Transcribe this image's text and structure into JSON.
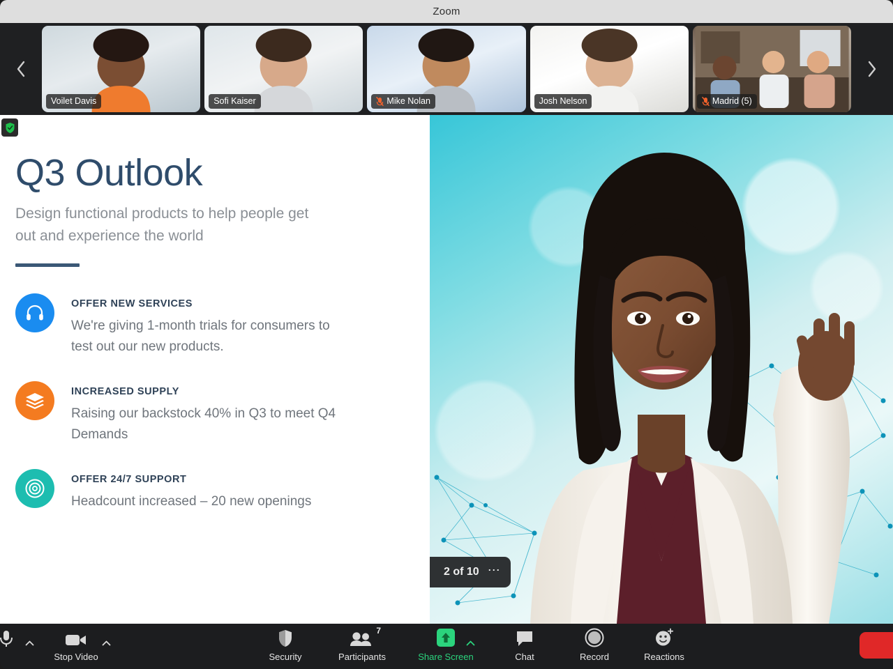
{
  "window": {
    "title": "Zoom"
  },
  "filmstrip": {
    "prev_icon": "chevron-left-icon",
    "next_icon": "chevron-right-icon",
    "participants": [
      {
        "name": "Voilet Davis",
        "muted": false,
        "active": false
      },
      {
        "name": "Sofi Kaiser",
        "muted": false,
        "active": false
      },
      {
        "name": "Mike Nolan",
        "muted": true,
        "active": true
      },
      {
        "name": "Josh Nelson",
        "muted": false,
        "active": false
      },
      {
        "name": "Madrid (5)",
        "muted": true,
        "active": false
      }
    ]
  },
  "slide": {
    "screen_share_badge_icon": "green-shield-icon",
    "title": "Q3 Outlook",
    "subtitle": "Design functional products to help people get out and experience the world",
    "bullets": [
      {
        "icon": "headphones-icon",
        "color": "#1a8cf0",
        "heading": "OFFER NEW SERVICES",
        "body": "We're giving 1-month trials for consumers to test out our new products."
      },
      {
        "icon": "layers-icon",
        "color": "#f47b20",
        "heading": "INCREASED SUPPLY",
        "body": "Raising our backstock 40% in Q3 to meet Q4 Demands"
      },
      {
        "icon": "lifebuoy-icon",
        "color": "#1dbdb0",
        "heading": "OFFER 24/7 SUPPORT",
        "body": "Headcount increased – 20 new openings"
      }
    ]
  },
  "slide_nav": {
    "prev_icon": "chevron-left-icon",
    "next_icon": "chevron-right-icon",
    "counter": "2 of 10",
    "more_icon": "ellipsis-icon"
  },
  "toolbar": {
    "mute": {
      "label": "",
      "icon": "microphone-icon",
      "caret_icon": "chevron-up-icon"
    },
    "video": {
      "label": "Stop Video",
      "icon": "video-camera-icon",
      "caret_icon": "chevron-up-icon"
    },
    "security": {
      "label": "Security",
      "icon": "shield-icon"
    },
    "participants": {
      "label": "Participants",
      "icon": "people-icon",
      "count": "7"
    },
    "share": {
      "label": "Share Screen",
      "icon": "share-arrow-up-icon",
      "caret_icon": "chevron-up-icon",
      "active_color": "#2bd47d"
    },
    "chat": {
      "label": "Chat",
      "icon": "chat-bubble-icon"
    },
    "record": {
      "label": "Record",
      "icon": "record-circle-icon"
    },
    "reactions": {
      "label": "Reactions",
      "icon": "smiley-face-icon"
    },
    "end": {
      "label": "",
      "icon": "end-call-icon",
      "color": "#e02828"
    }
  }
}
